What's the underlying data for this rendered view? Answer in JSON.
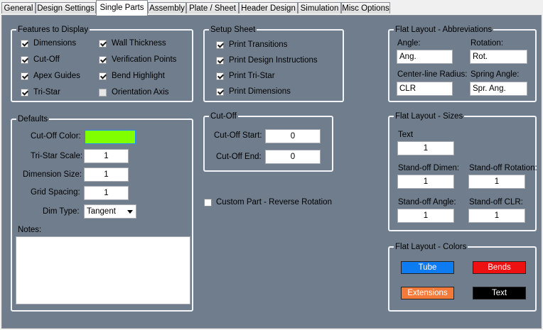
{
  "tabs": [
    "General",
    "Design Settings",
    "Single Parts",
    "Assembly",
    "Plate / Sheet",
    "Header Design",
    "Simulation",
    "Misc Options"
  ],
  "features": {
    "title": "Features to Display",
    "items": [
      {
        "label": "Dimensions",
        "checked": true
      },
      {
        "label": "Cut-Off",
        "checked": true
      },
      {
        "label": "Apex Guides",
        "checked": true
      },
      {
        "label": "Tri-Star",
        "checked": true
      },
      {
        "label": "Wall Thickness",
        "checked": true
      },
      {
        "label": "Verification Points",
        "checked": true
      },
      {
        "label": "Bend Highlight",
        "checked": true
      },
      {
        "label": "Orientation Axis",
        "checked": false
      }
    ]
  },
  "setup": {
    "title": "Setup Sheet",
    "items": [
      {
        "label": "Print Transitions",
        "checked": true
      },
      {
        "label": "Print Design Instructions",
        "checked": true
      },
      {
        "label": "Print Tri-Star",
        "checked": true
      },
      {
        "label": "Print Dimensions",
        "checked": true
      }
    ]
  },
  "defaults": {
    "title": "Defaults",
    "cutoff_color_label": "Cut-Off Color:",
    "cutoff_color": "#80ff00",
    "tristar_scale_label": "Tri-Star Scale:",
    "tristar_scale": "1",
    "dimension_size_label": "Dimension Size:",
    "dimension_size": "1",
    "grid_spacing_label": "Grid Spacing:",
    "grid_spacing": "1",
    "dim_type_label": "Dim Type:",
    "dim_type": "Tangent",
    "notes_label": "Notes:"
  },
  "cutoff": {
    "title": "Cut-Off",
    "start_label": "Cut-Off Start:",
    "start": "0",
    "end_label": "Cut-Off End:",
    "end": "0"
  },
  "custom_reverse": {
    "label": "Custom Part - Reverse Rotation",
    "checked": false
  },
  "abbrev": {
    "title": "Flat Layout - Abbreviations",
    "angle_label": "Angle:",
    "angle": "Ang.",
    "rotation_label": "Rotation:",
    "rotation": "Rot.",
    "clr_label": "Center-line Radius:",
    "clr": "CLR",
    "spring_label": "Spring Angle:",
    "spring": "Spr. Ang."
  },
  "sizes": {
    "title": "Flat Layout - Sizes",
    "text_label": "Text",
    "text": "1",
    "dimen_label": "Stand-off Dimen:",
    "dimen": "1",
    "rotation_label": "Stand-off Rotation:",
    "rotation": "1",
    "angle_label": "Stand-off  Angle:",
    "angle": "1",
    "clr_label": "Stand-off  CLR:",
    "clr": "1"
  },
  "colors": {
    "title": "Flat Layout - Colors",
    "tube": {
      "label": "Tube",
      "bg": "#0d7cf2",
      "fg": "#ffffff"
    },
    "bends": {
      "label": "Bends",
      "bg": "#ee1111",
      "fg": "#ffffff"
    },
    "extensions": {
      "label": "Extensions",
      "bg": "#f47a3a",
      "fg": "#ffffff"
    },
    "text": {
      "label": "Text",
      "bg": "#000000",
      "fg": "#ffffff"
    }
  }
}
